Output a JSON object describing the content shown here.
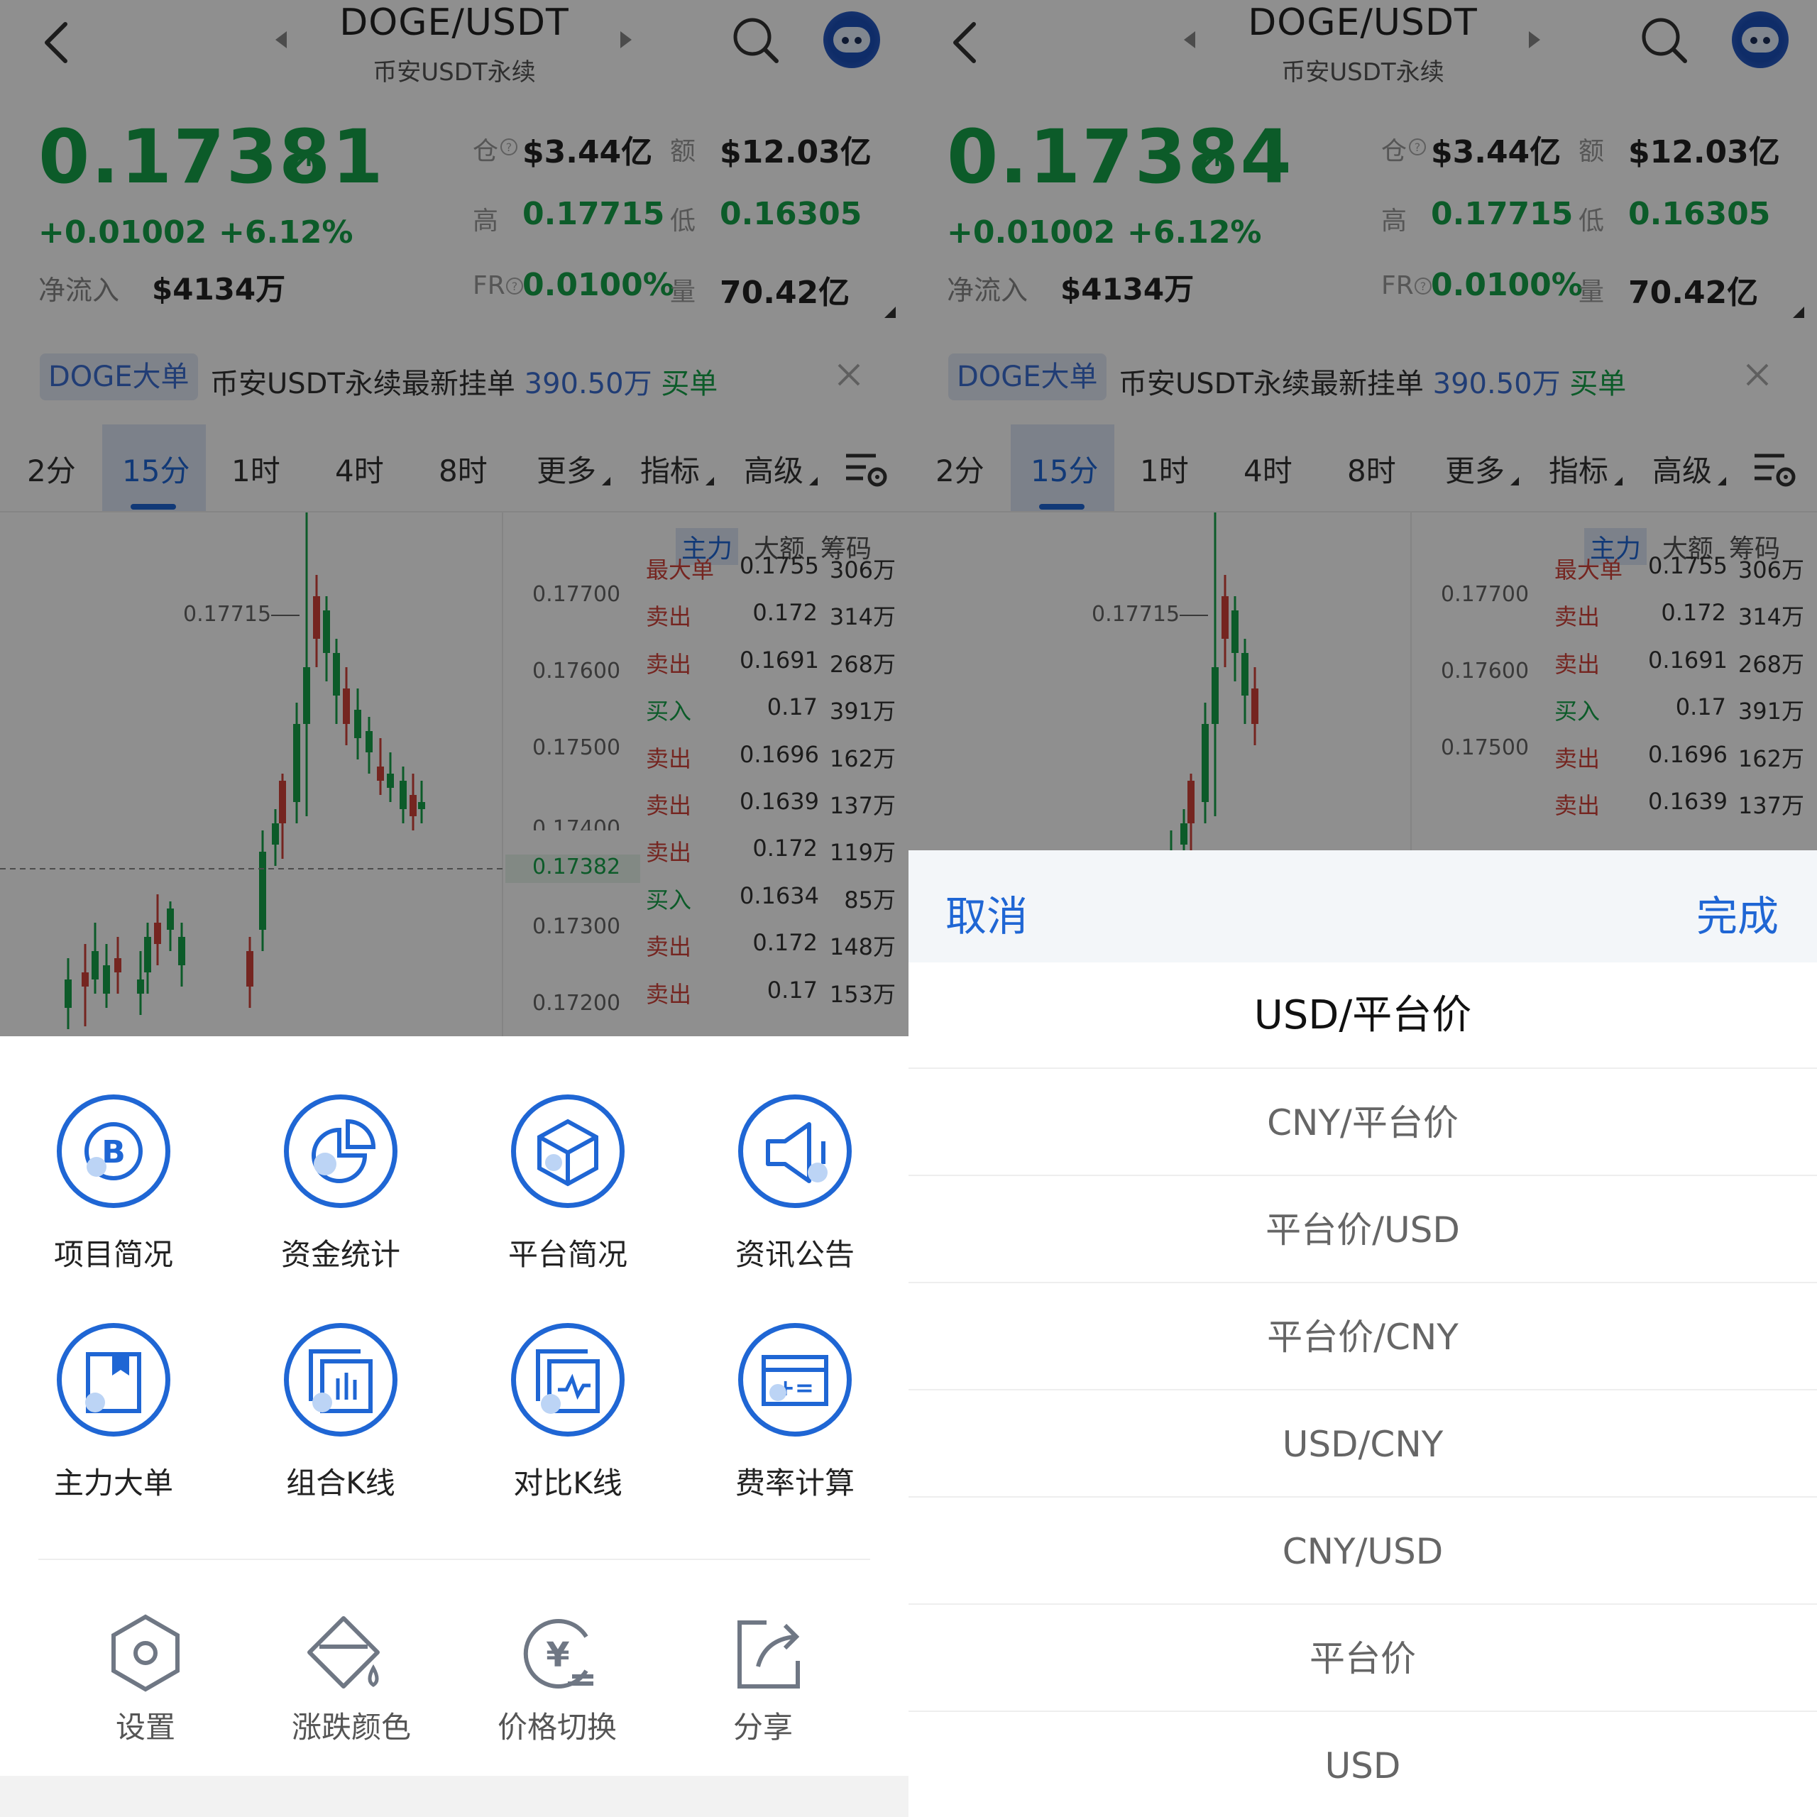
{
  "header": {
    "pair": "DOGE/USDT",
    "subtitle": "币安USDT永续"
  },
  "screens": {
    "left": {
      "last_price": "0.17381",
      "change_abs": "+0.01002",
      "change_pct": "+6.12%",
      "netflow_label": "净流入",
      "netflow_value": "$4134万",
      "stats": {
        "oi_label": "仓",
        "oi_value": "$3.44亿",
        "turnover_label": "额",
        "turnover_value": "$12.03亿",
        "high_label": "高",
        "high_value": "0.17715",
        "low_label": "低",
        "low_value": "0.16305",
        "fr_label": "FR",
        "fr_value": "0.0100%",
        "vol_label": "量",
        "vol_value": "70.42亿"
      }
    },
    "right": {
      "last_price": "0.17384"
    }
  },
  "notice": {
    "badge": "DOGE大单",
    "text": "币安USDT永续最新挂单 ",
    "amount": "390.50万",
    "side": " 买单"
  },
  "timeframes": [
    "2分",
    "15分",
    "1时",
    "4时",
    "8时",
    "更多",
    "指标",
    "高级"
  ],
  "chart": {
    "high_label": "0.17715",
    "current_price_label": "0.17382",
    "y_ticks": [
      "0.17700",
      "0.17600",
      "0.17500",
      "0.17400",
      "0.17300",
      "0.17200"
    ]
  },
  "orderbook": {
    "tabs": [
      "主力",
      "大额",
      "筹码"
    ],
    "rows": [
      {
        "type": "最大单",
        "price": "0.1755",
        "amount": "306万"
      },
      {
        "type": "卖出",
        "price": "0.172",
        "amount": "314万"
      },
      {
        "type": "卖出",
        "price": "0.1691",
        "amount": "268万"
      },
      {
        "type": "买入",
        "price": "0.17",
        "amount": "391万"
      },
      {
        "type": "卖出",
        "price": "0.1696",
        "amount": "162万"
      },
      {
        "type": "卖出",
        "price": "0.1639",
        "amount": "137万"
      },
      {
        "type": "卖出",
        "price": "0.172",
        "amount": "119万"
      },
      {
        "type": "买入",
        "price": "0.1634",
        "amount": "85万"
      },
      {
        "type": "卖出",
        "price": "0.172",
        "amount": "148万"
      },
      {
        "type": "卖出",
        "price": "0.17",
        "amount": "153万"
      }
    ]
  },
  "tools_menu": {
    "primary": [
      {
        "label": "项目简况",
        "icon": "project-b-icon"
      },
      {
        "label": "资金统计",
        "icon": "pie-chart-icon"
      },
      {
        "label": "平台简况",
        "icon": "cube-icon"
      },
      {
        "label": "资讯公告",
        "icon": "speaker-icon"
      },
      {
        "label": "主力大单",
        "icon": "bookmark-icon"
      },
      {
        "label": "组合K线",
        "icon": "combined-kline-icon"
      },
      {
        "label": "对比K线",
        "icon": "compare-kline-icon"
      },
      {
        "label": "费率计算",
        "icon": "calculator-icon"
      }
    ],
    "secondary": [
      {
        "label": "设置",
        "icon": "hexagon-settings-icon"
      },
      {
        "label": "涨跌颜色",
        "icon": "paint-bucket-icon"
      },
      {
        "label": "价格切换",
        "icon": "yen-switch-icon"
      },
      {
        "label": "分享",
        "icon": "share-icon"
      }
    ]
  },
  "picker": {
    "cancel": "取消",
    "done": "完成",
    "selected": "USD/平台价",
    "options": [
      "USD/平台价",
      "CNY/平台价",
      "平台价/USD",
      "平台价/CNY",
      "USD/CNY",
      "CNY/USD",
      "平台价",
      "USD"
    ]
  },
  "colors": {
    "up_green": "#17a34a",
    "down_red": "#d0423a",
    "accent_blue": "#1f66d4"
  }
}
